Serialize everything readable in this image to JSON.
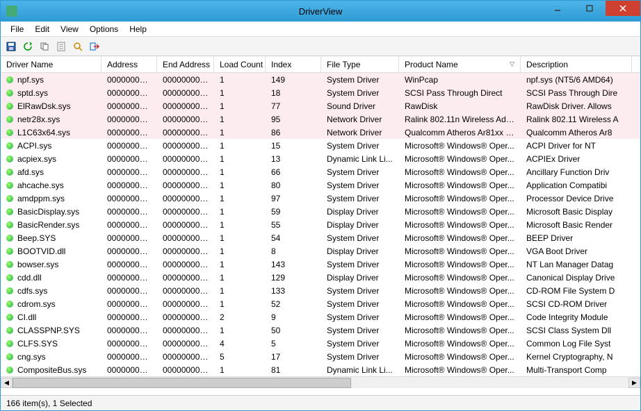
{
  "window": {
    "title": "DriverView"
  },
  "menu": {
    "items": [
      "File",
      "Edit",
      "View",
      "Options",
      "Help"
    ]
  },
  "columns": [
    {
      "label": "Driver Name",
      "cls": "c-name"
    },
    {
      "label": "Address",
      "cls": "c-addr"
    },
    {
      "label": "End Address",
      "cls": "c-eaddr"
    },
    {
      "label": "Load Count",
      "cls": "c-load"
    },
    {
      "label": "Index",
      "cls": "c-idx"
    },
    {
      "label": "File Type",
      "cls": "c-ftype"
    },
    {
      "label": "Product Name",
      "cls": "c-prod",
      "sorted": "▽"
    },
    {
      "label": "Description",
      "cls": "c-desc"
    }
  ],
  "rows": [
    {
      "hl": true,
      "name": "npf.sys",
      "addr": "00000000`0...",
      "eaddr": "00000000`0...",
      "load": "1",
      "idx": "149",
      "ftype": "System Driver",
      "prod": "WinPcap",
      "desc": "npf.sys (NT5/6 AMD64)"
    },
    {
      "hl": true,
      "name": "sptd.sys",
      "addr": "00000000`0...",
      "eaddr": "00000000`0...",
      "load": "1",
      "idx": "18",
      "ftype": "System Driver",
      "prod": "SCSI Pass Through Direct",
      "desc": "SCSI Pass Through Dire"
    },
    {
      "hl": true,
      "name": "ElRawDsk.sys",
      "addr": "00000000`0...",
      "eaddr": "00000000`0...",
      "load": "1",
      "idx": "77",
      "ftype": "Sound Driver",
      "prod": "RawDisk",
      "desc": "RawDisk Driver. Allows"
    },
    {
      "hl": true,
      "name": "netr28x.sys",
      "addr": "00000000`0...",
      "eaddr": "00000000`0...",
      "load": "1",
      "idx": "95",
      "ftype": "Network Driver",
      "prod": "Ralink 802.11n Wireless Adapt...",
      "desc": "Ralink 802.11 Wireless A"
    },
    {
      "hl": true,
      "name": "L1C63x64.sys",
      "addr": "00000000`0...",
      "eaddr": "00000000`0...",
      "load": "1",
      "idx": "86",
      "ftype": "Network Driver",
      "prod": "Qualcomm Atheros Ar81xx ser...",
      "desc": "Qualcomm Atheros Ar8"
    },
    {
      "hl": false,
      "name": "ACPI.sys",
      "addr": "00000000`0...",
      "eaddr": "00000000`0...",
      "load": "1",
      "idx": "15",
      "ftype": "System Driver",
      "prod": "Microsoft® Windows® Oper...",
      "desc": "ACPI Driver for NT"
    },
    {
      "hl": false,
      "name": "acpiex.sys",
      "addr": "00000000`0...",
      "eaddr": "00000000`0...",
      "load": "1",
      "idx": "13",
      "ftype": "Dynamic Link Li...",
      "prod": "Microsoft® Windows® Oper...",
      "desc": "ACPIEx Driver"
    },
    {
      "hl": false,
      "name": "afd.sys",
      "addr": "00000000`0...",
      "eaddr": "00000000`0...",
      "load": "1",
      "idx": "66",
      "ftype": "System Driver",
      "prod": "Microsoft® Windows® Oper...",
      "desc": "Ancillary Function Driv"
    },
    {
      "hl": false,
      "name": "ahcache.sys",
      "addr": "00000000`0...",
      "eaddr": "00000000`0...",
      "load": "1",
      "idx": "80",
      "ftype": "System Driver",
      "prod": "Microsoft® Windows® Oper...",
      "desc": "Application Compatibi"
    },
    {
      "hl": false,
      "name": "amdppm.sys",
      "addr": "00000000`0...",
      "eaddr": "00000000`0...",
      "load": "1",
      "idx": "97",
      "ftype": "System Driver",
      "prod": "Microsoft® Windows® Oper...",
      "desc": "Processor Device Drive"
    },
    {
      "hl": false,
      "name": "BasicDisplay.sys",
      "addr": "00000000`0...",
      "eaddr": "00000000`0...",
      "load": "1",
      "idx": "59",
      "ftype": "Display Driver",
      "prod": "Microsoft® Windows® Oper...",
      "desc": "Microsoft Basic Display"
    },
    {
      "hl": false,
      "name": "BasicRender.sys",
      "addr": "00000000`0...",
      "eaddr": "00000000`0...",
      "load": "1",
      "idx": "55",
      "ftype": "Display Driver",
      "prod": "Microsoft® Windows® Oper...",
      "desc": "Microsoft Basic Render"
    },
    {
      "hl": false,
      "name": "Beep.SYS",
      "addr": "00000000`0...",
      "eaddr": "00000000`0...",
      "load": "1",
      "idx": "54",
      "ftype": "System Driver",
      "prod": "Microsoft® Windows® Oper...",
      "desc": "BEEP Driver"
    },
    {
      "hl": false,
      "name": "BOOTVID.dll",
      "addr": "00000000`0...",
      "eaddr": "00000000`0...",
      "load": "1",
      "idx": "8",
      "ftype": "Display Driver",
      "prod": "Microsoft® Windows® Oper...",
      "desc": "VGA Boot Driver"
    },
    {
      "hl": false,
      "name": "bowser.sys",
      "addr": "00000000`0...",
      "eaddr": "00000000`0...",
      "load": "1",
      "idx": "143",
      "ftype": "System Driver",
      "prod": "Microsoft® Windows® Oper...",
      "desc": "NT Lan Manager Datag"
    },
    {
      "hl": false,
      "name": "cdd.dll",
      "addr": "00000000`0...",
      "eaddr": "00000000`0...",
      "load": "1",
      "idx": "129",
      "ftype": "Display Driver",
      "prod": "Microsoft® Windows® Oper...",
      "desc": "Canonical Display Drive"
    },
    {
      "hl": false,
      "name": "cdfs.sys",
      "addr": "00000000`0...",
      "eaddr": "00000000`0...",
      "load": "1",
      "idx": "133",
      "ftype": "System Driver",
      "prod": "Microsoft® Windows® Oper...",
      "desc": "CD-ROM File System D"
    },
    {
      "hl": false,
      "name": "cdrom.sys",
      "addr": "00000000`0...",
      "eaddr": "00000000`0...",
      "load": "1",
      "idx": "52",
      "ftype": "System Driver",
      "prod": "Microsoft® Windows® Oper...",
      "desc": "SCSI CD-ROM Driver"
    },
    {
      "hl": false,
      "name": "CI.dll",
      "addr": "00000000`0...",
      "eaddr": "00000000`0...",
      "load": "2",
      "idx": "9",
      "ftype": "System Driver",
      "prod": "Microsoft® Windows® Oper...",
      "desc": "Code Integrity Module"
    },
    {
      "hl": false,
      "name": "CLASSPNP.SYS",
      "addr": "00000000`0...",
      "eaddr": "00000000`0...",
      "load": "1",
      "idx": "50",
      "ftype": "System Driver",
      "prod": "Microsoft® Windows® Oper...",
      "desc": "SCSI Class System Dll"
    },
    {
      "hl": false,
      "name": "CLFS.SYS",
      "addr": "00000000`0...",
      "eaddr": "00000000`0...",
      "load": "4",
      "idx": "5",
      "ftype": "System Driver",
      "prod": "Microsoft® Windows® Oper...",
      "desc": "Common Log File Syst"
    },
    {
      "hl": false,
      "name": "cng.sys",
      "addr": "00000000`0...",
      "eaddr": "00000000`0...",
      "load": "5",
      "idx": "17",
      "ftype": "System Driver",
      "prod": "Microsoft® Windows® Oper...",
      "desc": "Kernel Cryptography, N"
    },
    {
      "hl": false,
      "name": "CompositeBus.sys",
      "addr": "00000000`0...",
      "eaddr": "00000000`0...",
      "load": "1",
      "idx": "81",
      "ftype": "Dynamic Link Li...",
      "prod": "Microsoft® Windows® Oper...",
      "desc": "Multi-Transport Comp"
    }
  ],
  "status": "166 item(s), 1 Selected"
}
